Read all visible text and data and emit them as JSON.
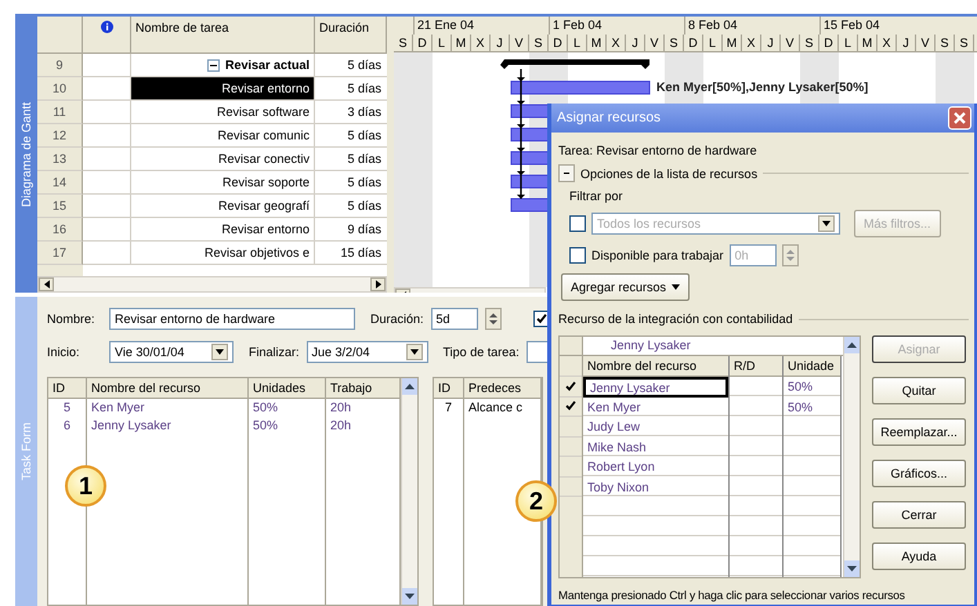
{
  "gantt": {
    "side_label": "Diagrama de Gantt",
    "columns": [
      {
        "label": "Nombre de tarea"
      },
      {
        "label": "Duración"
      }
    ],
    "weeks": [
      "21 Ene 04",
      "1 Feb 04",
      "8 Feb 04",
      "15 Feb 04"
    ],
    "days": [
      "S",
      "D",
      "L",
      "M",
      "X",
      "J",
      "V",
      "S",
      "D",
      "L",
      "M",
      "X",
      "J",
      "V",
      "S",
      "D",
      "L",
      "M",
      "X",
      "J",
      "V",
      "S",
      "D",
      "L",
      "M",
      "X",
      "J",
      "V",
      "S",
      "S"
    ],
    "rows": [
      {
        "id": "9",
        "name": "Revisar actual",
        "duration": "5 días",
        "kind": "summary",
        "expanded": true,
        "selected": false,
        "bar": true
      },
      {
        "id": "10",
        "name": "Revisar entorno",
        "duration": "5 días",
        "kind": "task",
        "selected": true,
        "bar": true,
        "bar_label": "Ken Myer[50%],Jenny Lysaker[50%]"
      },
      {
        "id": "11",
        "name": "Revisar software",
        "duration": "3 días",
        "kind": "task",
        "selected": false,
        "bar": true
      },
      {
        "id": "12",
        "name": "Revisar comunic",
        "duration": "5 días",
        "kind": "task",
        "selected": false,
        "bar": true
      },
      {
        "id": "13",
        "name": "Revisar conectiv",
        "duration": "5 días",
        "kind": "task",
        "selected": false,
        "bar": true
      },
      {
        "id": "14",
        "name": "Revisar soporte",
        "duration": "5 días",
        "kind": "task",
        "selected": false,
        "bar": true
      },
      {
        "id": "15",
        "name": "Revisar geografí",
        "duration": "5 días",
        "kind": "task",
        "selected": false,
        "bar": true
      },
      {
        "id": "16",
        "name": "Revisar entorno",
        "duration": "9 días",
        "kind": "task",
        "selected": false,
        "bar": false
      },
      {
        "id": "17",
        "name": "Revisar objetivos e",
        "duration": "15 días",
        "kind": "task",
        "selected": false,
        "bar": false
      }
    ]
  },
  "task_form": {
    "side_label": "Task Form",
    "name_label": "Nombre:",
    "name_value": "Revisar entorno de hardware",
    "duration_label": "Duración:",
    "duration_value": "5d",
    "effort_checked": true,
    "start_label": "Inicio:",
    "start_value": "Vie 30/01/04",
    "finish_label": "Finalizar:",
    "finish_value": "Jue 3/2/04",
    "type_label": "Tipo de tarea:",
    "resources": {
      "columns": [
        "ID",
        "Nombre del recurso",
        "Unidades",
        "Trabajo"
      ],
      "rows": [
        {
          "cells": [
            "5",
            "Ken Myer",
            "50%",
            "20h"
          ]
        },
        {
          "cells": [
            "6",
            "Jenny Lysaker",
            "50%",
            "20h"
          ]
        }
      ]
    },
    "predecessors": {
      "columns": [
        "ID",
        "Predeces"
      ],
      "rows": [
        {
          "cells": [
            "7",
            "Alcance c"
          ]
        }
      ]
    }
  },
  "dialog": {
    "title": "Asignar recursos",
    "task": "Tarea: Revisar entorno de hardware",
    "options_label": "Opciones de la lista de recursos",
    "filter_label": "Filtrar por",
    "filter_checked": false,
    "filter_value": "Todos los recursos",
    "more_filters": {
      "label": "Más filtros...",
      "disabled": true
    },
    "available_checked": false,
    "available_label": "Disponible para trabajar",
    "available_value": "0h",
    "add_button": "Agregar recursos",
    "group_label": "Recurso de la integración con contabilidad",
    "edit_value": "Jenny Lysaker",
    "columns": [
      "Nombre del recurso",
      "R/D",
      "Unidade"
    ],
    "rows": [
      {
        "assigned": true,
        "name": "Jenny Lysaker",
        "units": "50%",
        "selected": true
      },
      {
        "assigned": true,
        "name": "Ken Myer",
        "units": "50%",
        "selected": false
      },
      {
        "assigned": false,
        "name": "Judy Lew",
        "selected": false
      },
      {
        "assigned": false,
        "name": "Mike Nash",
        "selected": false
      },
      {
        "assigned": false,
        "name": "Robert Lyon",
        "selected": false
      },
      {
        "assigned": false,
        "name": "Toby Nixon",
        "selected": false
      }
    ],
    "buttons": [
      {
        "label": "Asignar",
        "disabled": true
      },
      {
        "label": "Quitar",
        "disabled": false
      },
      {
        "label": "Reemplazar...",
        "disabled": false
      },
      {
        "label": "Gráficos...",
        "disabled": false
      },
      {
        "label": "Cerrar",
        "disabled": false
      },
      {
        "label": "Ayuda",
        "disabled": false
      }
    ],
    "hint": "Mantenga presionado Ctrl y haga clic para seleccionar varios recursos"
  },
  "callouts": [
    {
      "label": "1"
    },
    {
      "label": "2"
    }
  ]
}
